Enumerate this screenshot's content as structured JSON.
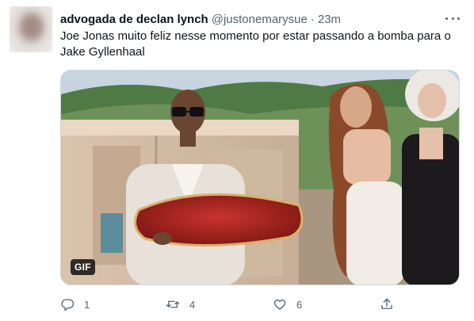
{
  "tweet": {
    "display_name": "advogada de declan lynch",
    "handle": "@justonemarysue",
    "separator": "·",
    "time": "23m",
    "text": "Joe Jonas muito feliz nesse momento por estar passando a bomba para o Jake Gyllenhaal",
    "media_badge": "GIF"
  },
  "actions": {
    "replies": "1",
    "retweets": "4",
    "likes": "6"
  },
  "icons": {
    "more": "more-horizontal-icon",
    "reply": "reply-icon",
    "retweet": "retweet-icon",
    "like": "heart-icon",
    "share": "share-icon"
  },
  "colors": {
    "text_primary": "#0f1419",
    "text_secondary": "#536471",
    "border": "#cfd9de"
  }
}
